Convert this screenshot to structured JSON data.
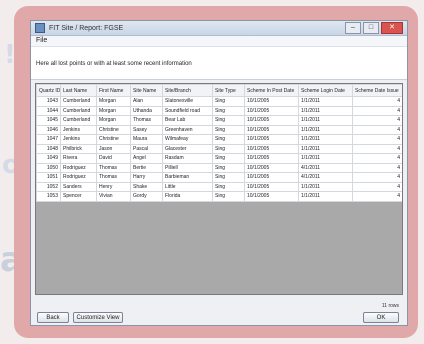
{
  "window": {
    "title": "FIT Site / Report: FGSE",
    "menu": "File",
    "instruction": "Here all lost points or with at least some recent information"
  },
  "table": {
    "headers": [
      "Quartz ID",
      "Last Name",
      "First Name",
      "Site Name",
      "Site/Branch",
      "Site Type",
      "Scheme In Post Date",
      "Scheme Login Date",
      "Scheme Date Issue"
    ],
    "rows": [
      [
        "1043",
        "Cumberland",
        "Morgan",
        "Alan",
        "Slatonesville",
        "Sing",
        "10/1/2005",
        "1/1/2011",
        "4"
      ],
      [
        "1044",
        "Cumberland",
        "Morgan",
        "Uthanda",
        "Soundfield road",
        "Sing",
        "10/1/2005",
        "1/1/2011",
        "4"
      ],
      [
        "1045",
        "Cumberland",
        "Morgan",
        "Thomas",
        "Bear Lab",
        "Sing",
        "10/1/2005",
        "1/1/2011",
        "4"
      ],
      [
        "1046",
        "Jenkins",
        "Christine",
        "Sasey",
        "Greenhaven",
        "Sing",
        "10/1/2005",
        "1/1/2011",
        "4"
      ],
      [
        "1047",
        "Jenkins",
        "Christine",
        "Maura",
        "Wilmafeay",
        "Sing",
        "10/1/2005",
        "1/1/2011",
        "4"
      ],
      [
        "1048",
        "Philbrick",
        "Jason",
        "Pascal",
        "Glacester",
        "Sing",
        "10/1/2005",
        "1/1/2011",
        "4"
      ],
      [
        "1049",
        "Rivera",
        "David",
        "Angel",
        "Rasdam",
        "Sing",
        "10/1/2005",
        "1/1/2011",
        "4"
      ],
      [
        "1050",
        "Rodriguez",
        "Thomas",
        "Bertie",
        "Pilliell",
        "Sing",
        "10/1/2005",
        "4/1/2011",
        "4"
      ],
      [
        "1051",
        "Rodriguez",
        "Thomas",
        "Harry",
        "Barbieman",
        "Sing",
        "10/1/2005",
        "4/1/2011",
        "4"
      ],
      [
        "1052",
        "Sanders",
        "Henry",
        "Shake",
        "Little",
        "Sing",
        "10/1/2005",
        "1/1/2011",
        "4"
      ],
      [
        "1053",
        "Spencer",
        "Vivian",
        "Gordy",
        "Florida",
        "Sing",
        "10/1/2005",
        "1/1/2011",
        "4"
      ]
    ]
  },
  "buttons": {
    "back": "Back",
    "customize": "Customize View",
    "ok": "OK"
  },
  "status": "11 rows"
}
